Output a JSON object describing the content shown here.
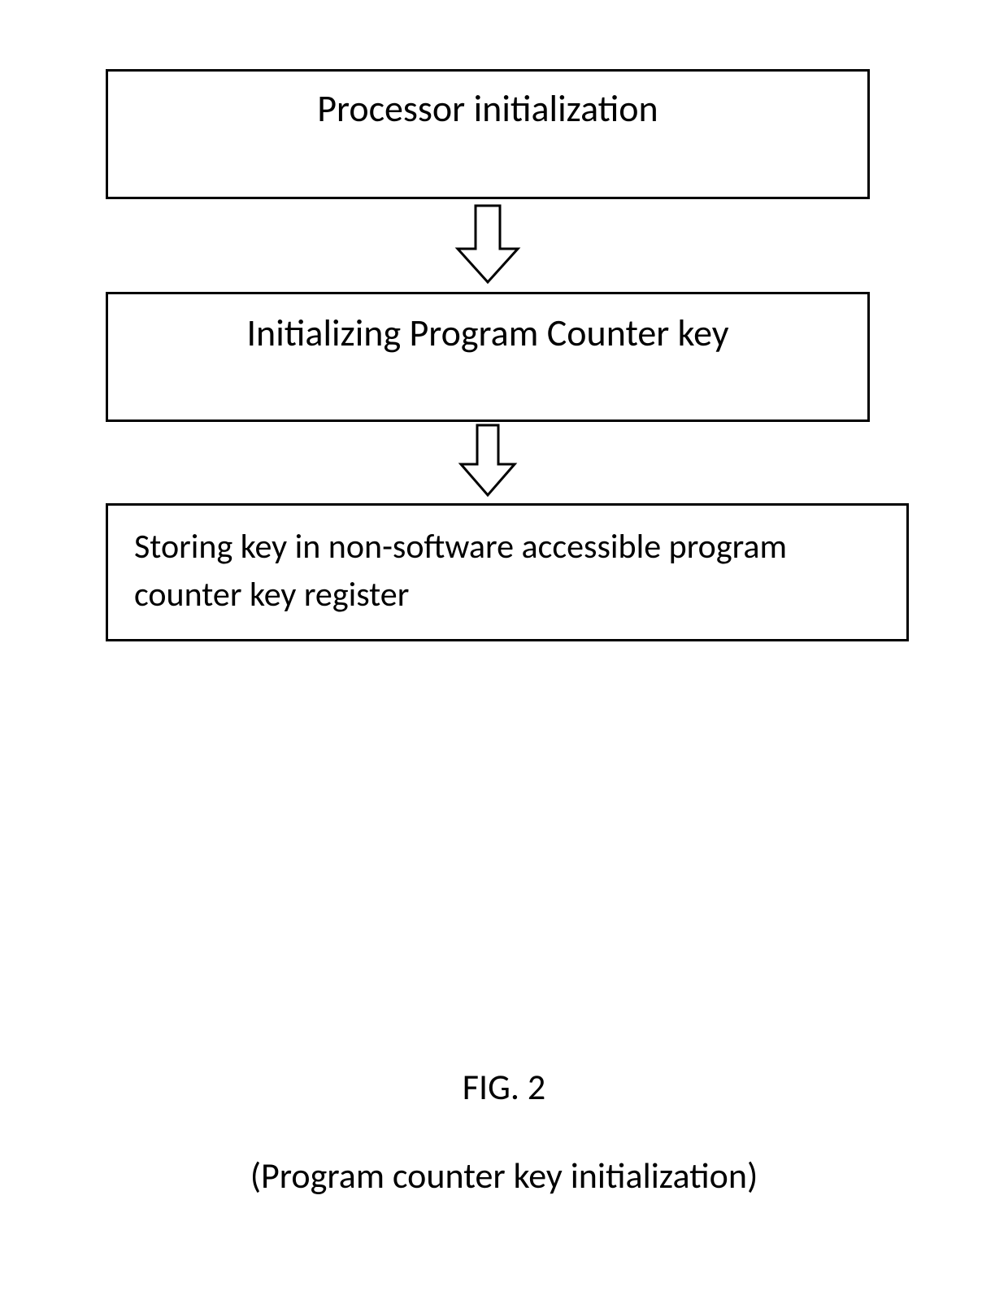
{
  "boxes": {
    "step1": "Processor initialization",
    "step2": "Initializing Program Counter key",
    "step3": "Storing key in non-software accessible program counter key register"
  },
  "caption": {
    "fig_label": "FIG. 2",
    "subtitle": "(Program counter key initialization)"
  }
}
